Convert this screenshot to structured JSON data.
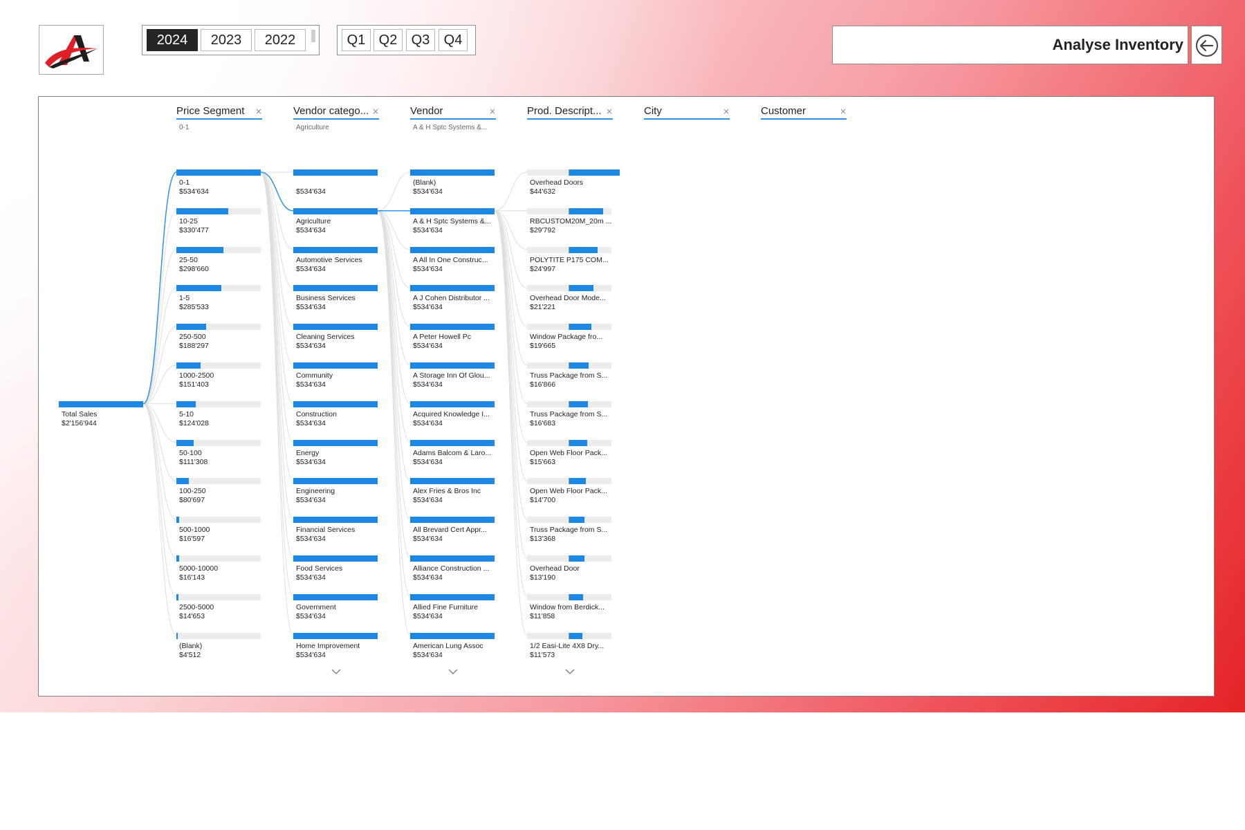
{
  "app": {
    "title": "Analyse Inventory"
  },
  "filters": {
    "years": [
      {
        "label": "2024",
        "active": true
      },
      {
        "label": "2023",
        "active": false
      },
      {
        "label": "2022",
        "active": false
      }
    ],
    "quarters": [
      "Q1",
      "Q2",
      "Q3",
      "Q4"
    ]
  },
  "colors": {
    "accent": "#1d87e4",
    "track": "#ececec",
    "link": "#2f93e8",
    "active_button": "#252525",
    "logo_red": "#e01e25",
    "logo_dark": "#1e1e1e"
  },
  "icons": {
    "logo": "brand-logo",
    "back": "back-arrow-circle-icon",
    "remove": "close-icon",
    "expand": "chevron-down-icon"
  },
  "tree": {
    "root": {
      "name": "Total Sales",
      "value": "$2'156'944"
    },
    "levels": [
      {
        "header": "Price Segment",
        "subtitle": "0-1",
        "selected": 0,
        "scroll": false,
        "nodes": [
          {
            "name": "0-1",
            "value": "$534'634",
            "fraction": 1.0
          },
          {
            "name": "10-25",
            "value": "$330'477",
            "fraction": 0.618
          },
          {
            "name": "25-50",
            "value": "$298'660",
            "fraction": 0.559
          },
          {
            "name": "1-5",
            "value": "$285'533",
            "fraction": 0.534
          },
          {
            "name": "250-500",
            "value": "$188'297",
            "fraction": 0.352
          },
          {
            "name": "1000-2500",
            "value": "$151'403",
            "fraction": 0.283
          },
          {
            "name": "5-10",
            "value": "$124'028",
            "fraction": 0.232
          },
          {
            "name": "50-100",
            "value": "$111'308",
            "fraction": 0.208
          },
          {
            "name": "100-250",
            "value": "$80'697",
            "fraction": 0.151
          },
          {
            "name": "500-1000",
            "value": "$16'597",
            "fraction": 0.031
          },
          {
            "name": "5000-10000",
            "value": "$16'143",
            "fraction": 0.03
          },
          {
            "name": "2500-5000",
            "value": "$14'653",
            "fraction": 0.027
          },
          {
            "name": "(Blank)",
            "value": "$4'512",
            "fraction": 0.008
          }
        ]
      },
      {
        "header": "Vendor catego...",
        "subtitle": "Agriculture",
        "selected": 1,
        "scroll": true,
        "nodes": [
          {
            "name": "",
            "value": "$534'634",
            "fraction": 1.0
          },
          {
            "name": "Agriculture",
            "value": "$534'634",
            "fraction": 1.0
          },
          {
            "name": "Automotive Services",
            "value": "$534'634",
            "fraction": 1.0
          },
          {
            "name": "Business Services",
            "value": "$534'634",
            "fraction": 1.0
          },
          {
            "name": "Cleaning Services",
            "value": "$534'634",
            "fraction": 1.0
          },
          {
            "name": "Community",
            "value": "$534'634",
            "fraction": 1.0
          },
          {
            "name": "Construction",
            "value": "$534'634",
            "fraction": 1.0
          },
          {
            "name": "Energy",
            "value": "$534'634",
            "fraction": 1.0
          },
          {
            "name": "Engineering",
            "value": "$534'634",
            "fraction": 1.0
          },
          {
            "name": "Financial Services",
            "value": "$534'634",
            "fraction": 1.0
          },
          {
            "name": "Food Services",
            "value": "$534'634",
            "fraction": 1.0
          },
          {
            "name": "Government",
            "value": "$534'634",
            "fraction": 1.0
          },
          {
            "name": "Home Improvement",
            "value": "$534'634",
            "fraction": 1.0
          }
        ]
      },
      {
        "header": "Vendor",
        "subtitle": "A & H Sptc Systems &...",
        "selected": 1,
        "scroll": true,
        "nodes": [
          {
            "name": "(Blank)",
            "value": "$534'634",
            "fraction": 1.0
          },
          {
            "name": "A & H Sptc Systems &...",
            "value": "$534'634",
            "fraction": 1.0
          },
          {
            "name": "A All In One Construc...",
            "value": "$534'634",
            "fraction": 1.0
          },
          {
            "name": "A J Cohen Distributor ...",
            "value": "$534'634",
            "fraction": 1.0
          },
          {
            "name": "A Peter Howell Pc",
            "value": "$534'634",
            "fraction": 1.0
          },
          {
            "name": "A Storage Inn Of Glou...",
            "value": "$534'634",
            "fraction": 1.0
          },
          {
            "name": "Acquired Knowledge I...",
            "value": "$534'634",
            "fraction": 1.0
          },
          {
            "name": "Adams Balcom & Laro...",
            "value": "$534'634",
            "fraction": 1.0
          },
          {
            "name": "Alex Fries & Bros Inc",
            "value": "$534'634",
            "fraction": 1.0
          },
          {
            "name": "All Brevard Cert Appr...",
            "value": "$534'634",
            "fraction": 1.0
          },
          {
            "name": "Alliance Construction ...",
            "value": "$534'634",
            "fraction": 1.0
          },
          {
            "name": "Allied Fine Furniture",
            "value": "$534'634",
            "fraction": 1.0
          },
          {
            "name": "American Lung Assoc",
            "value": "$534'634",
            "fraction": 1.0
          }
        ]
      },
      {
        "header": "Prod. Descript...",
        "subtitle": "",
        "selected": -1,
        "scroll": true,
        "nodes": [
          {
            "name": "Overhead Doors",
            "value": "$44'632",
            "fraction": 0.0835
          },
          {
            "name": "RBCUSTOM20M_20m ...",
            "value": "$29'792",
            "fraction": 0.0557
          },
          {
            "name": "POLYTITE P175 COM...",
            "value": "$24'997",
            "fraction": 0.0468
          },
          {
            "name": "Overhead Door Mode...",
            "value": "$21'221",
            "fraction": 0.0397
          },
          {
            "name": "Window Package fro...",
            "value": "$19'665",
            "fraction": 0.0368
          },
          {
            "name": "Truss Package from S...",
            "value": "$16'866",
            "fraction": 0.0315
          },
          {
            "name": "Truss Package from S...",
            "value": "$16'683",
            "fraction": 0.0312
          },
          {
            "name": "Open Web Floor Pack...",
            "value": "$15'663",
            "fraction": 0.0293
          },
          {
            "name": "Open Web Floor Pack...",
            "value": "$14'700",
            "fraction": 0.0275
          },
          {
            "name": "Truss Package from S...",
            "value": "$13'368",
            "fraction": 0.025
          },
          {
            "name": "Overhead Door",
            "value": "$13'190",
            "fraction": 0.0247
          },
          {
            "name": "Window from Berdick...",
            "value": "$11'858",
            "fraction": 0.0222
          },
          {
            "name": "1/2 Easi-Lite 4X8 Dry...",
            "value": "$11'573",
            "fraction": 0.0216
          }
        ]
      },
      {
        "header": "City",
        "subtitle": "",
        "selected": -1,
        "scroll": false,
        "nodes": []
      },
      {
        "header": "Customer",
        "subtitle": "",
        "selected": -1,
        "scroll": false,
        "nodes": []
      }
    ]
  }
}
